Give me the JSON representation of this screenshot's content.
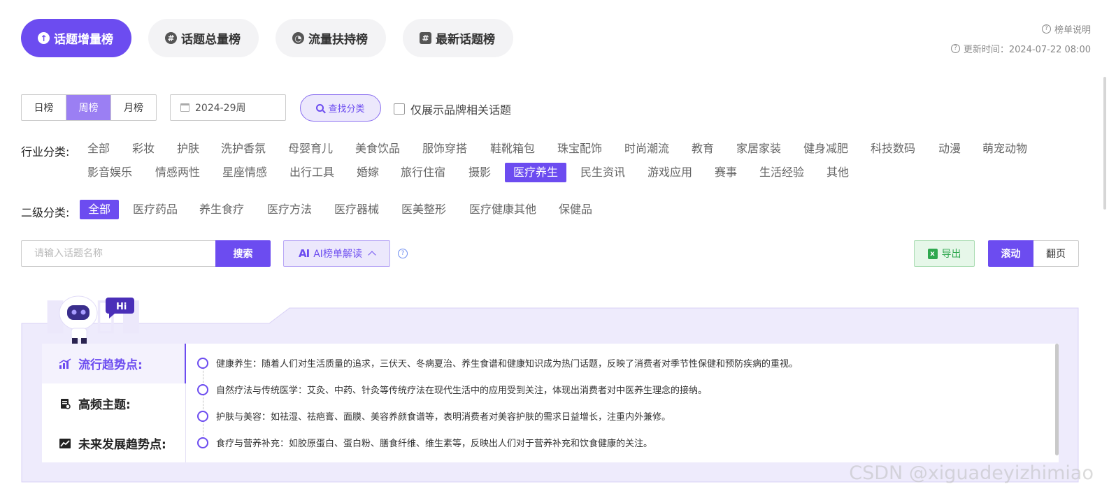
{
  "top_tabs": [
    {
      "label": "话题增量榜",
      "icon": "arrow-up-circle-icon",
      "active": true
    },
    {
      "label": "话题总量榜",
      "icon": "hash-circle-icon",
      "active": false
    },
    {
      "label": "流量扶持榜",
      "icon": "gauge-icon",
      "active": false
    },
    {
      "label": "最新话题榜",
      "icon": "hash-chat-icon",
      "active": false
    }
  ],
  "header": {
    "explain_label": "榜单说明",
    "update_time": "更新时间：2024-07-22 08:00"
  },
  "period": {
    "options": [
      "日榜",
      "周榜",
      "月榜"
    ],
    "selected": "周榜"
  },
  "date_picker": {
    "value": "2024-29周"
  },
  "find_category_label": "查找分类",
  "brand_only_label": "仅展示品牌相关话题",
  "industry": {
    "label": "行业分类:",
    "row1": [
      "全部",
      "彩妆",
      "护肤",
      "洗护香氛",
      "母婴育儿",
      "美食饮品",
      "服饰穿搭",
      "鞋靴箱包",
      "珠宝配饰",
      "时尚潮流",
      "教育",
      "家居家装",
      "健身减肥",
      "科技数码",
      "动漫",
      "萌宠动物"
    ],
    "row2": [
      "影音娱乐",
      "情感两性",
      "星座情感",
      "出行工具",
      "婚嫁",
      "旅行住宿",
      "摄影",
      "医疗养生",
      "民生资讯",
      "游戏应用",
      "赛事",
      "生活经验",
      "其他"
    ],
    "selected": "医疗养生"
  },
  "sub_category": {
    "label": "二级分类:",
    "items": [
      "全部",
      "医疗药品",
      "养生食疗",
      "医疗方法",
      "医疗器械",
      "医美整形",
      "医疗健康其他",
      "保健品"
    ],
    "selected": "全部"
  },
  "search": {
    "placeholder": "请输入话题名称",
    "button": "搜索"
  },
  "ai_button": {
    "logo": "AI",
    "label": "AI榜单解读"
  },
  "export_label": "导出",
  "view_mode": {
    "options": [
      "滚动",
      "翻页"
    ],
    "selected": "滚动"
  },
  "ai_panel": {
    "robot_badge": "Hi",
    "nav": [
      {
        "label": "流行趋势点:",
        "icon": "bar-chart-icon",
        "active": true
      },
      {
        "label": "高频主题:",
        "icon": "document-icon",
        "active": false
      },
      {
        "label": "未来发展趋势点:",
        "icon": "trend-line-icon",
        "active": false
      }
    ],
    "trends": [
      "健康养生：随着人们对生活质量的追求，三伏天、冬病夏治、养生食谱和健康知识成为热门话题，反映了消费者对季节性保健和预防疾病的重视。",
      "自然疗法与传统医学：艾灸、中药、针灸等传统疗法在现代生活中的应用受到关注，体现出消费者对中医养生理念的接纳。",
      "护肤与美容：如祛湿、祛疤膏、面膜、美容养颜食谱等，表明消费者对美容护肤的需求日益增长，注重内外兼修。",
      "食疗与营养补充：如胶原蛋白、蛋白粉、膳食纤维、维生素等，反映出人们对于营养补充和饮食健康的关注。"
    ]
  },
  "watermark": "CSDN @xiguadeyizhimiao",
  "colors": {
    "accent": "#6c4cf0",
    "accent_light": "#ece8fc",
    "export_green": "#2fa84f",
    "panel_bg": "#eeebfc"
  }
}
